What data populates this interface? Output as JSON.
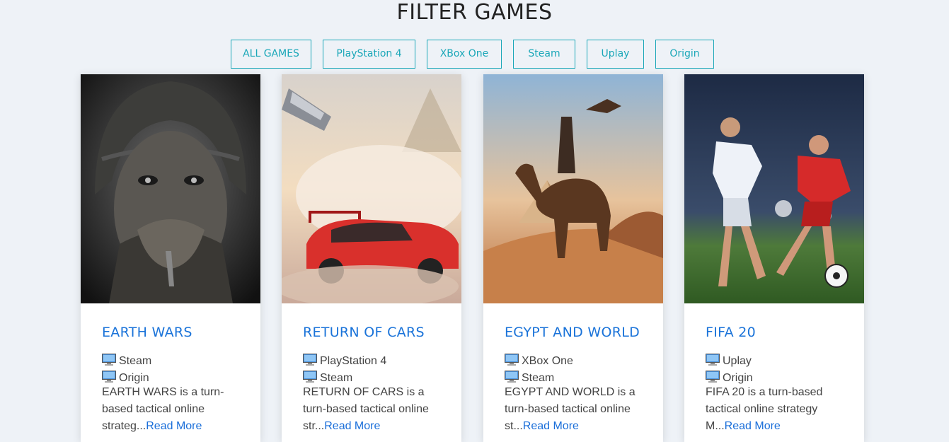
{
  "page_title": "FILTER GAMES",
  "filters": [
    "ALL GAMES",
    "PlayStation 4",
    "XBox One",
    "Steam",
    "Uplay",
    "Origin"
  ],
  "read_more_label": "Read More",
  "cards": [
    {
      "title": "EARTH WARS",
      "platforms": [
        "Steam",
        "Origin"
      ],
      "description": "EARTH WARS is a turn-based tactical online strateg...",
      "art": "soldier-portrait"
    },
    {
      "title": "RETURN OF CARS",
      "platforms": [
        "PlayStation 4",
        "Steam"
      ],
      "description": "RETURN OF CARS is a turn-based tactical online str...",
      "art": "red-car-explosion"
    },
    {
      "title": "EGYPT AND WORLD",
      "platforms": [
        "XBox One",
        "Steam"
      ],
      "description": "EGYPT AND WORLD is a turn-based tactical online st...",
      "art": "camel-rider-desert"
    },
    {
      "title": "FIFA 20",
      "platforms": [
        "Uplay",
        "Origin"
      ],
      "description": "FIFA 20 is a turn-based tactical online strategy M...",
      "art": "football-players"
    }
  ],
  "colors": {
    "accent": "#1aa7b8",
    "title_blue": "#1a73d9",
    "link": "#1a6ed9",
    "background": "#eef2f7"
  }
}
